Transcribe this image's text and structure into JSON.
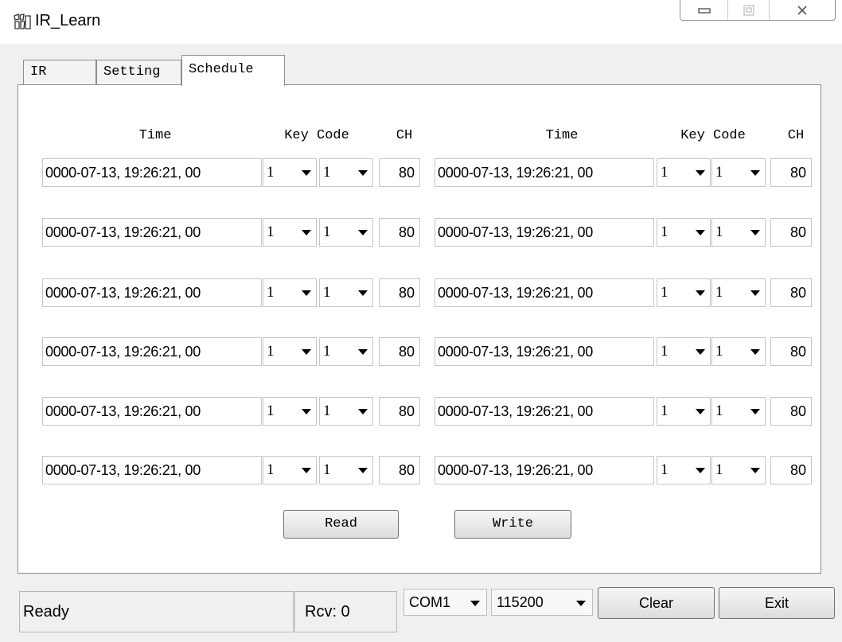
{
  "window": {
    "title": "IR_Learn"
  },
  "tabs": [
    {
      "label": "IR"
    },
    {
      "label": "Setting"
    },
    {
      "label": "Schedule"
    }
  ],
  "schedule": {
    "headers": {
      "time": "Time",
      "key_code": "Key Code",
      "ch": "CH"
    },
    "left_rows": [
      {
        "time": "0000-07-13, 19:26:21, 00",
        "key": "1",
        "code": "1",
        "ch": "80"
      },
      {
        "time": "0000-07-13, 19:26:21, 00",
        "key": "1",
        "code": "1",
        "ch": "80"
      },
      {
        "time": "0000-07-13, 19:26:21, 00",
        "key": "1",
        "code": "1",
        "ch": "80"
      },
      {
        "time": "0000-07-13, 19:26:21, 00",
        "key": "1",
        "code": "1",
        "ch": "80"
      },
      {
        "time": "0000-07-13, 19:26:21, 00",
        "key": "1",
        "code": "1",
        "ch": "80"
      },
      {
        "time": "0000-07-13, 19:26:21, 00",
        "key": "1",
        "code": "1",
        "ch": "80"
      }
    ],
    "right_rows": [
      {
        "time": "0000-07-13, 19:26:21, 00",
        "key": "1",
        "code": "1",
        "ch": "80"
      },
      {
        "time": "0000-07-13, 19:26:21, 00",
        "key": "1",
        "code": "1",
        "ch": "80"
      },
      {
        "time": "0000-07-13, 19:26:21, 00",
        "key": "1",
        "code": "1",
        "ch": "80"
      },
      {
        "time": "0000-07-13, 19:26:21, 00",
        "key": "1",
        "code": "1",
        "ch": "80"
      },
      {
        "time": "0000-07-13, 19:26:21, 00",
        "key": "1",
        "code": "1",
        "ch": "80"
      },
      {
        "time": "0000-07-13, 19:26:21, 00",
        "key": "1",
        "code": "1",
        "ch": "80"
      }
    ],
    "read_label": "Read",
    "write_label": "Write"
  },
  "status": {
    "state": "Ready",
    "rcv": "Rcv: 0",
    "port": "COM1",
    "baud": "115200",
    "clear_label": "Clear",
    "exit_label": "Exit"
  }
}
